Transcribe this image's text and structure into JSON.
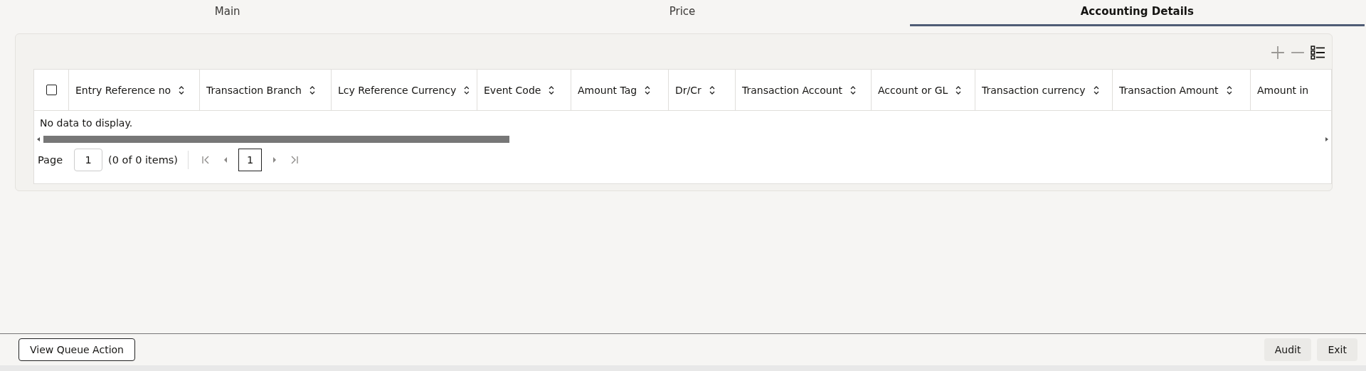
{
  "tabs": [
    {
      "label": "Main",
      "selected": false
    },
    {
      "label": "Price",
      "selected": false
    },
    {
      "label": "Accounting Details",
      "selected": true
    }
  ],
  "toolbar": [
    {
      "kind": "add",
      "disabled": true
    },
    {
      "kind": "remove",
      "disabled": true
    },
    {
      "kind": "columns",
      "disabled": false
    }
  ],
  "table": {
    "select_all": {
      "checked": false
    },
    "columns": [
      "Entry Reference no",
      "Transaction Branch",
      "Lcy Reference Currency",
      "Event Code",
      "Amount Tag",
      "Dr/Cr",
      "Transaction Account",
      "Account or GL",
      "Transaction currency",
      "Transaction Amount",
      "Amount in"
    ],
    "empty_message": "No data to display."
  },
  "pagination": {
    "label": "Page",
    "page_value": "1",
    "summary": "(0 of 0 items)",
    "current_page": "1",
    "nav": [
      {
        "kind": "first",
        "disabled": true
      },
      {
        "kind": "prev",
        "disabled": true
      },
      {
        "kind": "next",
        "disabled": true
      },
      {
        "kind": "last",
        "disabled": true
      }
    ]
  },
  "footer": {
    "left_buttons": [
      "View Queue Action"
    ],
    "right_buttons": [
      "Audit",
      "Exit"
    ]
  }
}
